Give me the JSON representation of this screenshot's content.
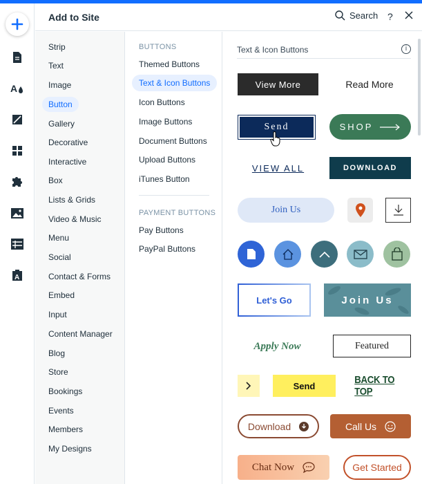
{
  "header": {
    "title": "Add to Site",
    "search_label": "Search",
    "help_label": "?"
  },
  "categories": [
    "Strip",
    "Text",
    "Image",
    "Button",
    "Gallery",
    "Decorative",
    "Interactive",
    "Box",
    "Lists & Grids",
    "Video & Music",
    "Menu",
    "Social",
    "Contact & Forms",
    "Embed",
    "Input",
    "Content Manager",
    "Blog",
    "Store",
    "Bookings",
    "Events",
    "Members",
    "My Designs"
  ],
  "active_category": "Button",
  "subcategories": {
    "buttons_heading": "BUTTONS",
    "buttons": [
      "Themed Buttons",
      "Text & Icon Buttons",
      "Icon Buttons",
      "Image Buttons",
      "Document Buttons",
      "Upload Buttons",
      "iTunes Button"
    ],
    "payment_heading": "PAYMENT BUTTONS",
    "payment": [
      "Pay Buttons",
      "PayPal Buttons"
    ]
  },
  "active_subcategory": "Text & Icon Buttons",
  "content": {
    "title": "Text & Icon Buttons",
    "info_label": "i",
    "buttons": {
      "view_more": "View More",
      "read_more": "Read More",
      "send_1": "Send",
      "shop": "SHOP",
      "view_all": "VIEW ALL",
      "download_1": "DOWNLOAD",
      "join_us_1": "Join Us",
      "lets_go": "Let's Go",
      "join_us_2": "Join Us",
      "apply_now": "Apply Now",
      "featured": "Featured",
      "send_2": "Send",
      "back_to_top": "BACK TO TOP",
      "download_2": "Download",
      "call_us": "Call Us",
      "chat_now": "Chat Now",
      "get_started": "Get Started"
    }
  },
  "colors": {
    "accent": "#116dff",
    "navy": "#0c2a5a",
    "green": "#3b7a57",
    "teal_dark": "#0f3c4c",
    "yellow": "#ffef5e",
    "rust": "#b45f33"
  }
}
